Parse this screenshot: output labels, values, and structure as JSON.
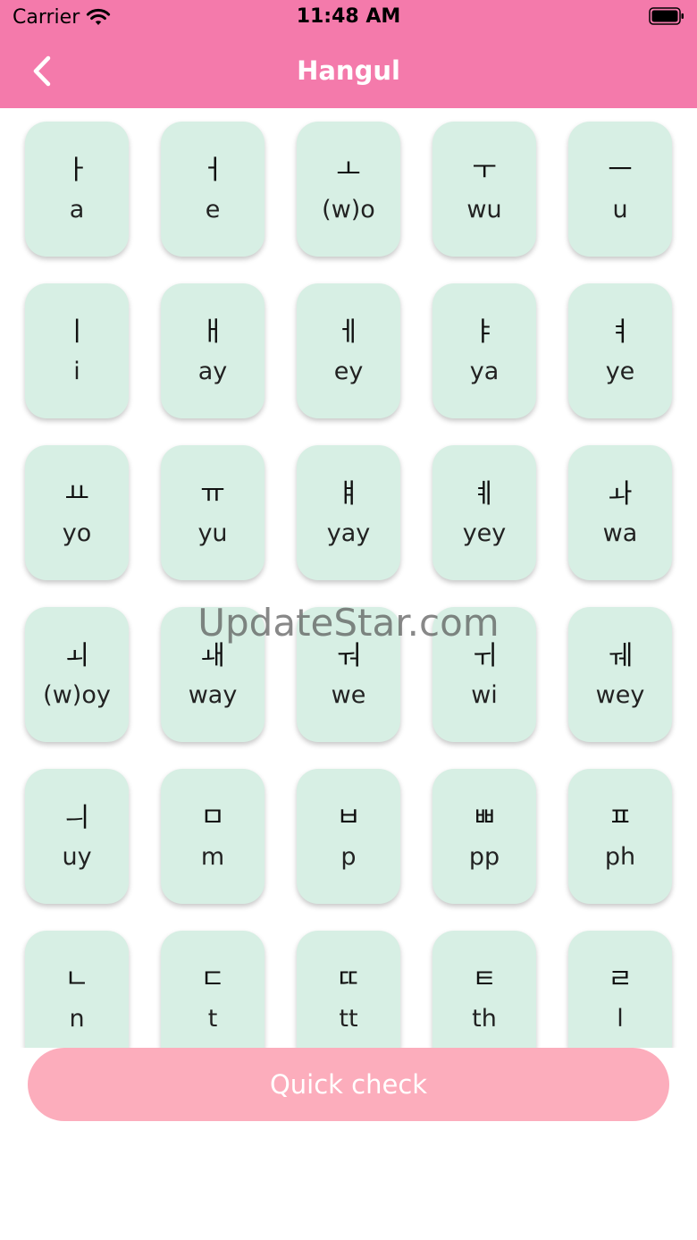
{
  "status_bar": {
    "carrier": "Carrier",
    "time": "11:48 AM"
  },
  "nav": {
    "title": "Hangul",
    "back_icon": "chevron-left-icon"
  },
  "letters": [
    {
      "hangul": "ㅏ",
      "roman": "a"
    },
    {
      "hangul": "ㅓ",
      "roman": "e"
    },
    {
      "hangul": "ㅗ",
      "roman": "(w)o"
    },
    {
      "hangul": "ㅜ",
      "roman": "wu"
    },
    {
      "hangul": "ㅡ",
      "roman": "u"
    },
    {
      "hangul": "ㅣ",
      "roman": "i"
    },
    {
      "hangul": "ㅐ",
      "roman": "ay"
    },
    {
      "hangul": "ㅔ",
      "roman": "ey"
    },
    {
      "hangul": "ㅑ",
      "roman": "ya"
    },
    {
      "hangul": "ㅕ",
      "roman": "ye"
    },
    {
      "hangul": "ㅛ",
      "roman": "yo"
    },
    {
      "hangul": "ㅠ",
      "roman": "yu"
    },
    {
      "hangul": "ㅒ",
      "roman": "yay"
    },
    {
      "hangul": "ㅖ",
      "roman": "yey"
    },
    {
      "hangul": "ㅘ",
      "roman": "wa"
    },
    {
      "hangul": "ㅚ",
      "roman": "(w)oy"
    },
    {
      "hangul": "ㅙ",
      "roman": "way"
    },
    {
      "hangul": "ㅝ",
      "roman": "we"
    },
    {
      "hangul": "ㅟ",
      "roman": "wi"
    },
    {
      "hangul": "ㅞ",
      "roman": "wey"
    },
    {
      "hangul": "ㅢ",
      "roman": "uy"
    },
    {
      "hangul": "ㅁ",
      "roman": "m"
    },
    {
      "hangul": "ㅂ",
      "roman": "p"
    },
    {
      "hangul": "ㅃ",
      "roman": "pp"
    },
    {
      "hangul": "ㅍ",
      "roman": "ph"
    },
    {
      "hangul": "ㄴ",
      "roman": "n"
    },
    {
      "hangul": "ㄷ",
      "roman": "t"
    },
    {
      "hangul": "ㄸ",
      "roman": "tt"
    },
    {
      "hangul": "ㅌ",
      "roman": "th"
    },
    {
      "hangul": "ㄹ",
      "roman": "l"
    }
  ],
  "watermark": "UpdateStar.com",
  "quick_check_label": "Quick check",
  "colors": {
    "header": "#f47aab",
    "card": "#d7efe4",
    "button": "#fcadbc"
  }
}
